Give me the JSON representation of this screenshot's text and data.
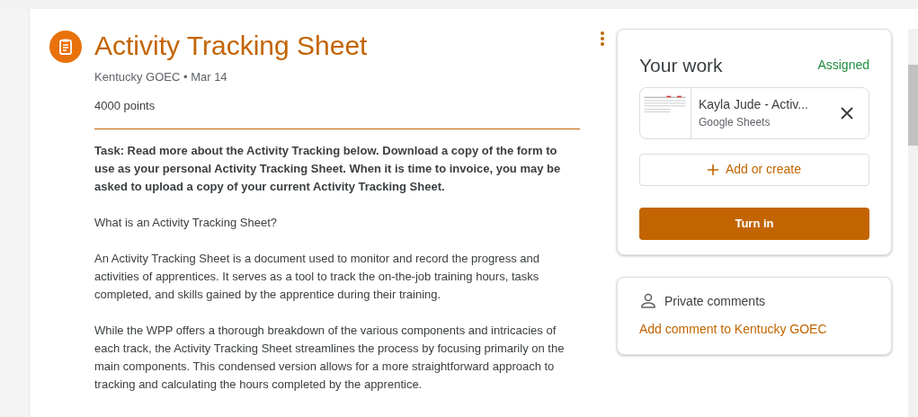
{
  "assignment": {
    "title": "Activity Tracking Sheet",
    "meta": "Kentucky GOEC • Mar 14",
    "points": "4000 points",
    "paragraphs": [
      {
        "kind": "bold",
        "text": "Task: Read more about the Activity Tracking below.  Download a copy of the form to use as your personal Activity Tracking Sheet.  When it is time to invoice, you may be asked to upload a copy of your current Activity Tracking Sheet."
      },
      {
        "kind": "plain",
        "text": "What is an Activity Tracking Sheet?"
      },
      {
        "kind": "plain",
        "text": "An Activity Tracking Sheet is a document used to monitor and record the progress and activities of apprentices. It serves as a tool to track the on-the-job training hours, tasks completed, and skills gained by the apprentice during their training."
      },
      {
        "kind": "plain",
        "text": "While the WPP offers a thorough breakdown of the various components and intricacies of each track, the Activity Tracking Sheet streamlines the process by focusing primarily on the main components. This condensed version allows for a more straightforward approach to tracking and calculating the hours completed by the apprentice."
      }
    ]
  },
  "your_work": {
    "title": "Your work",
    "status": "Assigned",
    "attachment": {
      "name": "Kayla Jude - Activ...",
      "type": "Google Sheets"
    },
    "add_button": "Add or create",
    "turn_in_button": "Turn in"
  },
  "private_comments": {
    "title": "Private comments",
    "link": "Add comment to Kentucky GOEC"
  }
}
